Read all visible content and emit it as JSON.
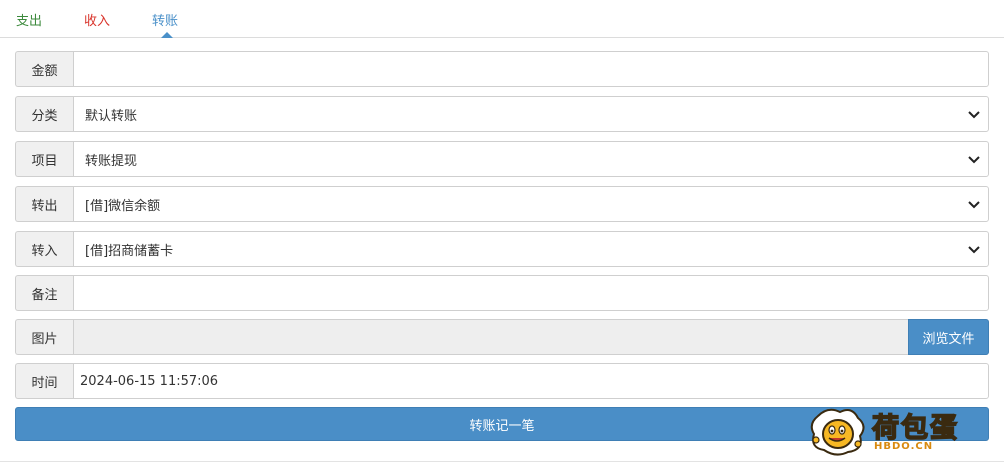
{
  "tabs": {
    "expense": "支出",
    "income": "收入",
    "transfer": "转账"
  },
  "form": {
    "amount": {
      "label": "金额",
      "value": ""
    },
    "category": {
      "label": "分类",
      "value": "默认转账"
    },
    "project": {
      "label": "项目",
      "value": "转账提现"
    },
    "from_account": {
      "label": "转出",
      "value": "[借]微信余额"
    },
    "to_account": {
      "label": "转入",
      "value": "[借]招商储蓄卡"
    },
    "note": {
      "label": "备注",
      "value": ""
    },
    "image": {
      "label": "图片",
      "browse_label": "浏览文件"
    },
    "time": {
      "label": "时间",
      "value": "2024-06-15 11:57:06"
    }
  },
  "submit_label": "转账记一笔",
  "watermark": {
    "text": "荷包蛋",
    "sub": "HBDO.CN"
  },
  "colors": {
    "expense_tab": "#3c8a3c",
    "income_tab": "#d9342b",
    "transfer_tab": "#4a90c9",
    "primary": "#4a8ec7"
  }
}
